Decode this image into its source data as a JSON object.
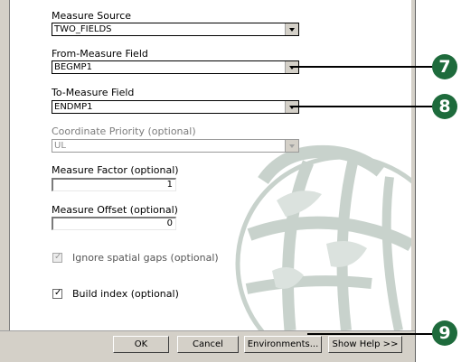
{
  "form": {
    "measure_source_label": "Measure Source",
    "measure_source_value": "TWO_FIELDS",
    "from_measure_label": "From-Measure Field",
    "from_measure_value": "BEGMP1",
    "to_measure_label": "To-Measure Field",
    "to_measure_value": "ENDMP1",
    "coordinate_priority_label": "Coordinate Priority (optional)",
    "coordinate_priority_value": "UL",
    "measure_factor_label": "Measure Factor (optional)",
    "measure_factor_value": "1",
    "measure_offset_label": "Measure Offset (optional)",
    "measure_offset_value": "0",
    "ignore_gaps_label": "Ignore spatial gaps (optional)",
    "build_index_label": "Build index (optional)",
    "check_mark": "✓"
  },
  "buttons": {
    "ok": "OK",
    "cancel": "Cancel",
    "environments": "Environments...",
    "show_help": "Show Help >>"
  },
  "callouts": {
    "seven": "7",
    "eight": "8",
    "nine": "9"
  },
  "colors": {
    "callout": "#1e6b3c",
    "dialog_bg": "#d4d0c8",
    "globe": "#c8d2cc"
  }
}
